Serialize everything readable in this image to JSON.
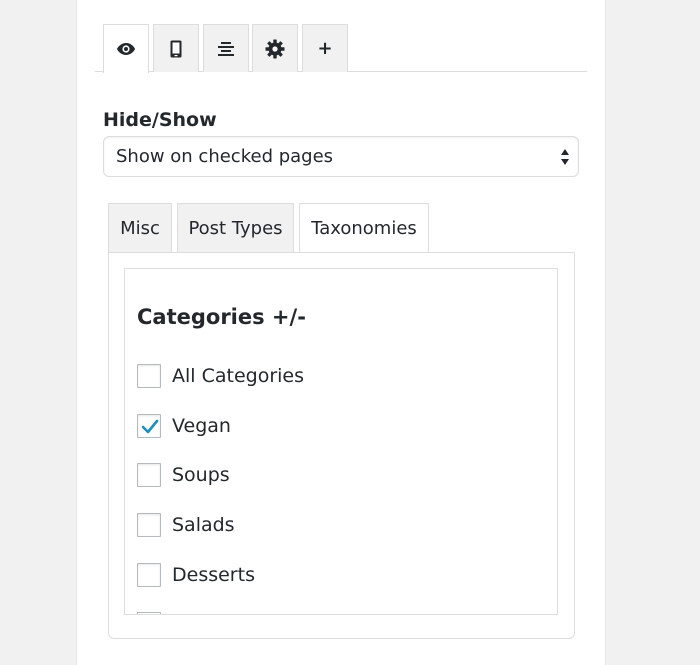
{
  "icon_tabs": [
    {
      "name": "visibility",
      "icon": "eye-icon",
      "active": true
    },
    {
      "name": "devices",
      "icon": "mobile-icon",
      "active": false
    },
    {
      "name": "alignment",
      "icon": "align-center-icon",
      "active": false
    },
    {
      "name": "settings",
      "icon": "gear-icon",
      "active": false
    },
    {
      "name": "more",
      "icon": "plus-icon",
      "label": "+",
      "active": false
    }
  ],
  "hide_show": {
    "label": "Hide/Show",
    "selected": "Show on checked pages"
  },
  "content_tabs": [
    {
      "label": "Misc",
      "active": false
    },
    {
      "label": "Post Types",
      "active": false
    },
    {
      "label": "Taxonomies",
      "active": true
    }
  ],
  "categories": {
    "heading": "Categories +/-",
    "items": [
      {
        "label": "All Categories",
        "checked": false
      },
      {
        "label": "Vegan",
        "checked": true
      },
      {
        "label": "Soups",
        "checked": false
      },
      {
        "label": "Salads",
        "checked": false
      },
      {
        "label": "Desserts",
        "checked": false
      }
    ]
  },
  "colors": {
    "check_mark": "#1e8cbe",
    "border": "#dddddd",
    "tab_inactive": "#f1f1f1"
  }
}
